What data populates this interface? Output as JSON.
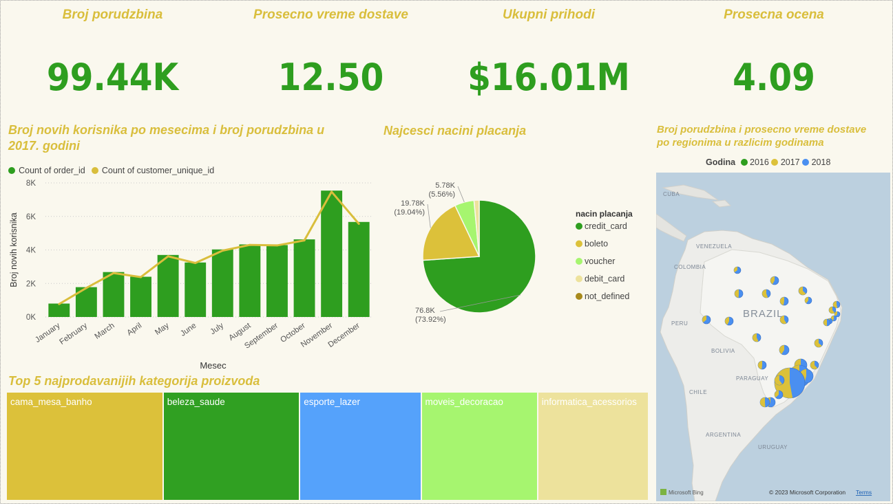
{
  "kpis": [
    {
      "title": "Broj porudzbina",
      "value": "99.44K"
    },
    {
      "title": "Prosecno vreme dostave",
      "value": "12.50"
    },
    {
      "title": "Ukupni prihodi",
      "value": "$16.01M"
    },
    {
      "title": "Prosecna ocena",
      "value": "4.09"
    }
  ],
  "combo": {
    "title_line1": "Broj novih korisnika po mesecima i broj porudzbina u",
    "title_line2": "2017. godini",
    "legend": [
      "Count of order_id",
      "Count of customer_unique_id"
    ],
    "xlabel": "Mesec",
    "ylabel": "Broj novih korisnika"
  },
  "pie": {
    "title": "Najcesci nacini placanja",
    "legend_title": "nacin placanja",
    "labels": {
      "credit_card": [
        "76.8K",
        "(73.92%)"
      ],
      "boleto": [
        "19.78K",
        "(19.04%)"
      ],
      "voucher": [
        "5.78K",
        "(5.56%)"
      ]
    }
  },
  "map": {
    "title_line1": "Broj porudzbina i prosecno vreme dostave",
    "title_line2": "po regionima u razlicim godinama",
    "legend_title": "Godina",
    "years": [
      "2016",
      "2017",
      "2018"
    ],
    "place_labels": [
      "CUBA",
      "VENEZUELA",
      "COLOMBIA",
      "PERU",
      "BRAZIL",
      "BOLIVIA",
      "PARAGUAY",
      "CHILE",
      "ARGENTINA",
      "URUGUAY"
    ],
    "attribution": "© 2023 Microsoft Corporation",
    "terms": "Terms",
    "bing": "Microsoft Bing"
  },
  "treemap": {
    "title": "Top 5 najprodavanijih kategorija proizvoda"
  },
  "chart_data": [
    {
      "type": "bar",
      "title": "Broj novih korisnika po mesecima i broj porudzbina u 2017. godini",
      "xlabel": "Mesec",
      "ylabel": "Broj novih korisnika",
      "ylim": [
        0,
        8000
      ],
      "yticks": [
        "0K",
        "2K",
        "4K",
        "6K",
        "8K"
      ],
      "grid": true,
      "legend_position": "top-left",
      "categories": [
        "January",
        "February",
        "March",
        "April",
        "May",
        "June",
        "July",
        "August",
        "September",
        "October",
        "November",
        "December"
      ],
      "series": [
        {
          "name": "Count of order_id",
          "kind": "bar",
          "color": "#2e9e1f",
          "values": [
            800,
            1780,
            2680,
            2400,
            3700,
            3250,
            4030,
            4330,
            4290,
            4630,
            7540,
            5670
          ]
        },
        {
          "name": "Count of customer_unique_id",
          "kind": "line",
          "color": "#d9be3c",
          "values": [
            770,
            1730,
            2620,
            2380,
            3620,
            3220,
            3960,
            4300,
            4270,
            4570,
            7470,
            5560
          ]
        }
      ]
    },
    {
      "type": "pie",
      "title": "Najcesci nacini placanja",
      "legend_title": "nacin placanja",
      "legend_position": "right",
      "categories": [
        "credit_card",
        "boleto",
        "voucher",
        "debit_card",
        "not_defined"
      ],
      "values": [
        76800,
        19780,
        5780,
        1530,
        3
      ],
      "percent": [
        73.92,
        19.04,
        5.56,
        1.47,
        0.0
      ],
      "colors": [
        "#2e9e1f",
        "#dcc13a",
        "#a6f56f",
        "#ede29c",
        "#a88a1c"
      ]
    },
    {
      "type": "treemap",
      "title": "Top 5 najprodavanijih kategorija proizvoda",
      "categories": [
        "cama_mesa_banho",
        "beleza_saude",
        "esporte_lazer",
        "moveis_decoracao",
        "informatica_acessorios"
      ],
      "relative_size": [
        226,
        197,
        175,
        168,
        160
      ],
      "colors": [
        "#dcc13a",
        "#30a022",
        "#55a2fb",
        "#a6f56f",
        "#ede29c"
      ]
    }
  ]
}
